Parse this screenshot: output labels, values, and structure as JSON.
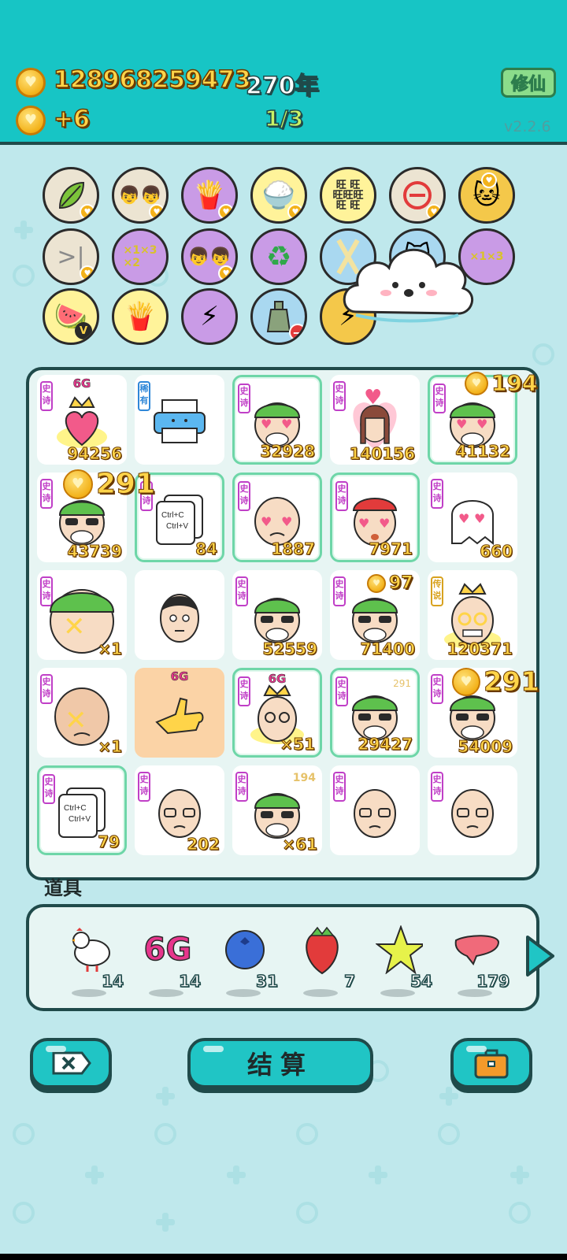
{
  "header": {
    "coins": "128968259473",
    "years": "270年",
    "coin_rate": "+6",
    "page": "1/3",
    "cultivate_label": "修仙",
    "version": "v2.2.6"
  },
  "board": {
    "cells": [
      {
        "tag": "史诗",
        "count": "94256",
        "badge": "6G"
      },
      {
        "tag": "稀有",
        "count": ""
      },
      {
        "tag": "史诗",
        "count": "32928"
      },
      {
        "tag": "史诗",
        "count": "140156"
      },
      {
        "tag": "史诗",
        "count": "41132"
      },
      {
        "tag": "史诗",
        "count": "43739"
      },
      {
        "tag": "史诗",
        "count": "84",
        "text": "Ctrl+C\nCtrl+V"
      },
      {
        "tag": "史诗",
        "count": "1887"
      },
      {
        "tag": "史诗",
        "count": "7971"
      },
      {
        "tag": "史诗",
        "count": "660"
      },
      {
        "tag": "史诗",
        "count": "×1"
      },
      {
        "tag": "",
        "count": ""
      },
      {
        "tag": "史诗",
        "count": "52559"
      },
      {
        "tag": "史诗",
        "count": "71400"
      },
      {
        "tag": "传说",
        "count": "120371"
      },
      {
        "tag": "史诗",
        "count": "×1"
      },
      {
        "tag": "",
        "count": "",
        "badge": "6G"
      },
      {
        "tag": "史诗",
        "count": "×51",
        "badge": "6G"
      },
      {
        "tag": "史诗",
        "count": "29427",
        "mini_bubble": "291"
      },
      {
        "tag": "史诗",
        "count": "54009"
      },
      {
        "tag": "史诗",
        "count": "79",
        "text": "Ctrl+C\nCtrl+V"
      },
      {
        "tag": "史诗",
        "count": "202"
      },
      {
        "tag": "史诗",
        "count": "×61",
        "mini_bubble": "194"
      },
      {
        "tag": "史诗",
        "count": ""
      },
      {
        "tag": "史诗",
        "count": ""
      }
    ],
    "bubbles": {
      "b1": "194",
      "b2": "291",
      "b3": "97",
      "b4": "291"
    }
  },
  "tools": {
    "label": "道具",
    "items": [
      {
        "icon": "chicken-icon",
        "count": "14"
      },
      {
        "icon": "6g-icon",
        "count": "14",
        "text": "6G"
      },
      {
        "icon": "blueberry-icon",
        "count": "31"
      },
      {
        "icon": "strawberry-icon",
        "count": "7"
      },
      {
        "icon": "star-icon",
        "count": "54"
      },
      {
        "icon": "liver-icon",
        "count": "179"
      }
    ]
  },
  "buttons": {
    "settle_label": "结算"
  },
  "colors": {
    "header_bg": "#17c5c5",
    "page_bg": "#bfe8ec",
    "coin_text": "#ffd449",
    "page_indicator": "#c9f266"
  }
}
